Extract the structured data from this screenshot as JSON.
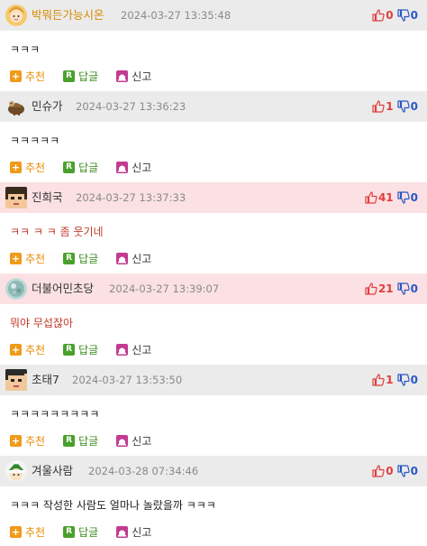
{
  "actions": {
    "recommend": "추천",
    "reply": "답글",
    "report": "신고",
    "reply_badge": "R"
  },
  "comments": [
    {
      "nick": "박뭐든가능시온",
      "date": "2024-03-27 13:35:48",
      "up": "0",
      "down": "0",
      "text": "ㅋㅋㅋ"
    },
    {
      "nick": "민슈가",
      "date": "2024-03-27 13:36:23",
      "up": "1",
      "down": "0",
      "text": "ㅋㅋㅋㅋㅋ"
    },
    {
      "nick": "진희국",
      "date": "2024-03-27 13:37:33",
      "up": "41",
      "down": "0",
      "text": "ㅋㅋ ㅋ ㅋ 좀 웃기네"
    },
    {
      "nick": "더불어민초당",
      "date": "2024-03-27 13:39:07",
      "up": "21",
      "down": "0",
      "text": "뭐야 무섭잖아"
    },
    {
      "nick": "초태7",
      "date": "2024-03-27 13:53:50",
      "up": "1",
      "down": "0",
      "text": "ㅋㅋㅋㅋㅋㅋㅋㅋㅋ"
    },
    {
      "nick": "겨울사람",
      "date": "2024-03-28 07:34:46",
      "up": "0",
      "down": "0",
      "text": "ㅋㅋㅋ 작성한 사람도 얼마나 놀랐을까 ㅋㅋㅋ"
    }
  ]
}
